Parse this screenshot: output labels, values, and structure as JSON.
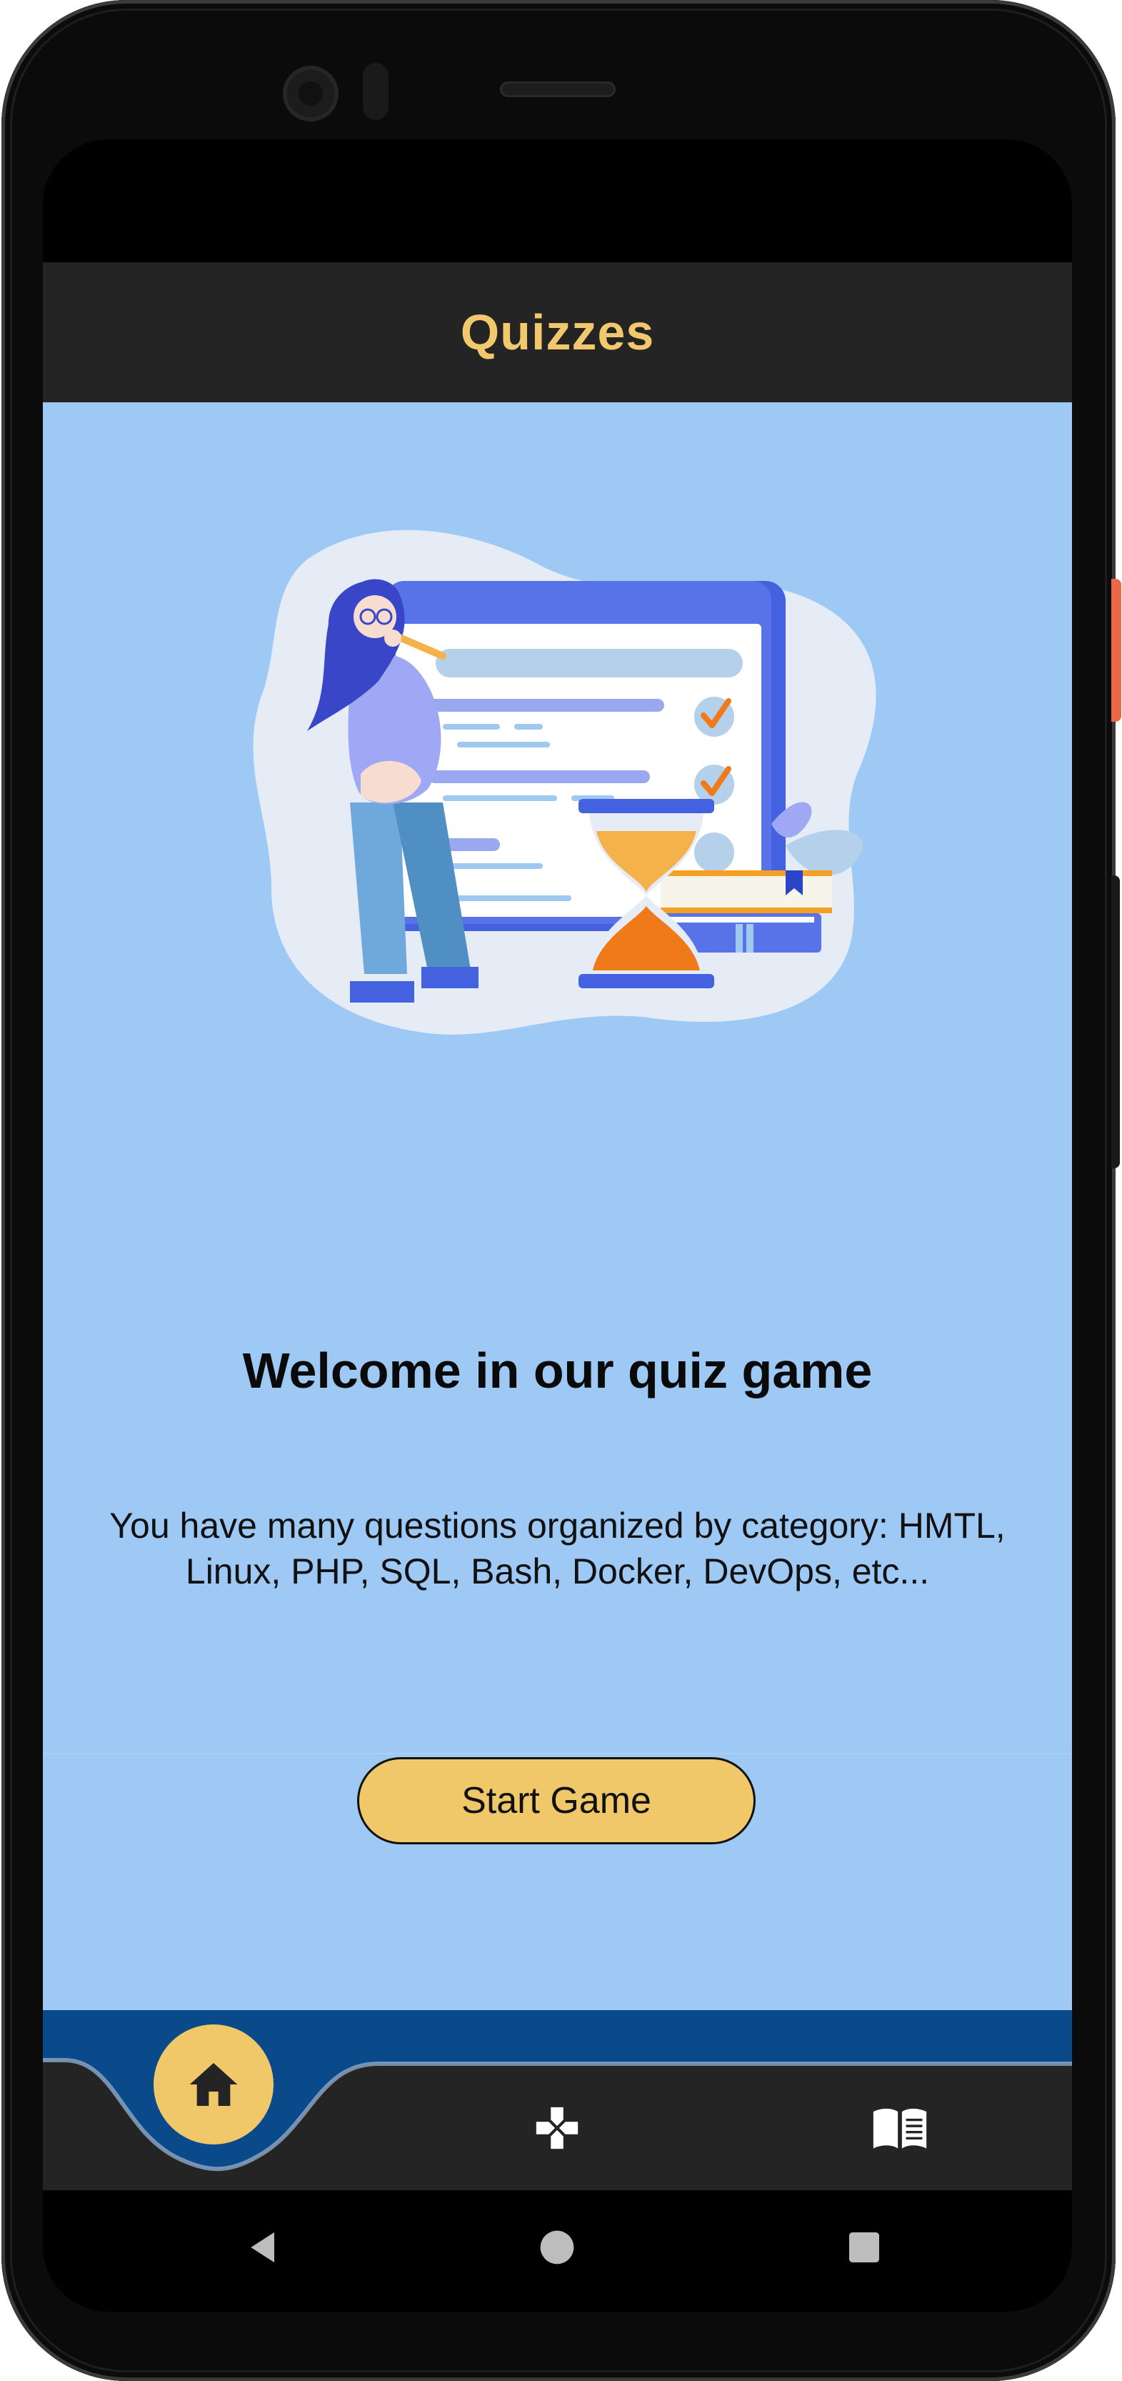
{
  "app_bar": {
    "title": "Quizzes"
  },
  "welcome": {
    "title": "Welcome in our quiz game",
    "description": "You have many questions organized by category: HMTL, Linux, PHP, SQL, Bash, Docker, DevOps, etc..."
  },
  "actions": {
    "start_label": "Start Game"
  },
  "bottom_nav": {
    "items": [
      {
        "icon": "home-icon",
        "active": true
      },
      {
        "icon": "gamepad-icon",
        "active": false
      },
      {
        "icon": "book-icon",
        "active": false
      }
    ]
  },
  "system_nav": {
    "buttons": [
      "back-icon",
      "home-circle-icon",
      "recents-icon"
    ]
  },
  "colors": {
    "accent": "#f0c86a",
    "app_bar": "#242424",
    "content_bg": "#9fc9f5",
    "nav_bar": "#242424",
    "nav_top_stripe": "#0a4a8a"
  }
}
